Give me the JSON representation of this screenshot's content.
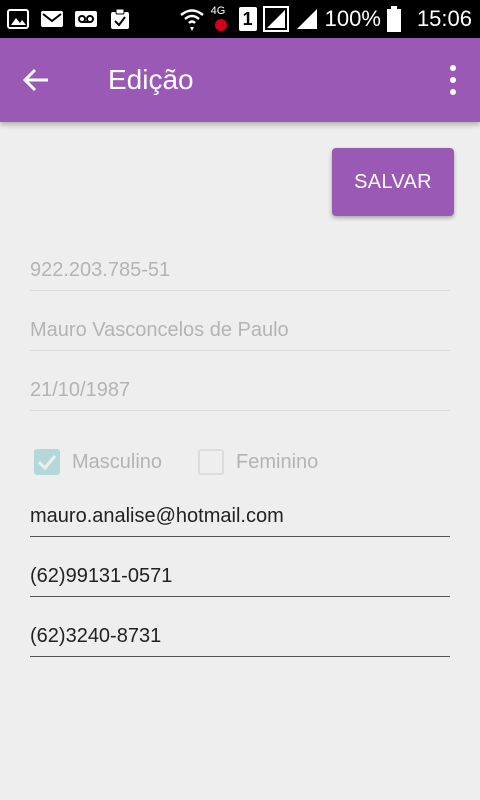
{
  "status_bar": {
    "battery_percent": "100%",
    "time": "15:06",
    "network_label": "4G",
    "sim_label": "1"
  },
  "app_bar": {
    "title": "Edição"
  },
  "save_button": {
    "label": "SALVAR"
  },
  "form": {
    "cpf": "922.203.785-51",
    "name": "Mauro Vasconcelos de Paulo",
    "birth_date": "21/10/1987",
    "gender": {
      "male_label": "Masculino",
      "male_checked": true,
      "female_label": "Feminino",
      "female_checked": false
    },
    "email": "mauro.analise@hotmail.com",
    "mobile": "(62)99131-0571",
    "phone": "(62)3240-8731"
  },
  "colors": {
    "primary": "#9b59b6",
    "background": "#eeeeee",
    "checkbox_checked": "#b4d8d8"
  }
}
